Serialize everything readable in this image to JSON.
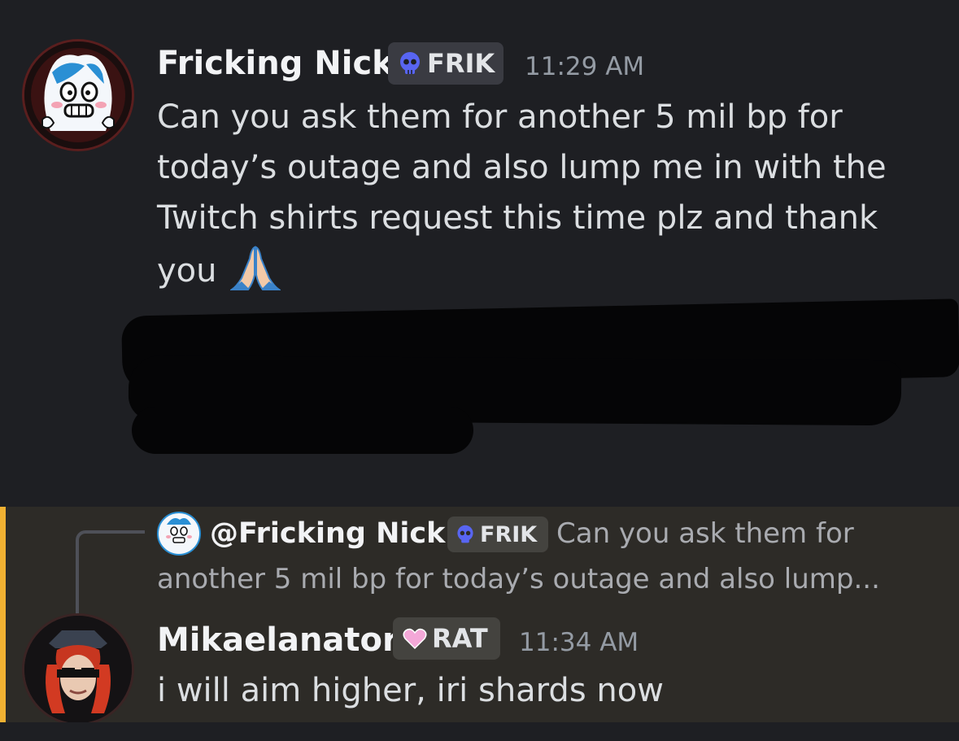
{
  "message1": {
    "author": "Fricking Nick",
    "tag": "FRIK",
    "time": "11:29 AM",
    "lines": [
      "Can you ask them for another 5 mil bp for",
      "today’s outage and also lump me in with the",
      "Twitch shirts request this time plz and thank",
      "you"
    ],
    "emoji": "folded-hands-emoji"
  },
  "message2": {
    "reply": {
      "mention": "@Fricking Nick",
      "tag": "FRIK",
      "preview_line1": "Can you ask them for",
      "preview_line2": "another 5 mil bp for today’s outage and also lump..."
    },
    "author": "Mikaelanator",
    "tag": "RAT",
    "time": "11:34 AM",
    "text": "i will aim higher, iri shards now"
  },
  "colors": {
    "background": "#1e1f23",
    "highlight_background": "#2d2b27",
    "mention_accent": "#f0b132",
    "frik_badge": "#5865f2",
    "rat_badge": "#f4a8d8"
  }
}
